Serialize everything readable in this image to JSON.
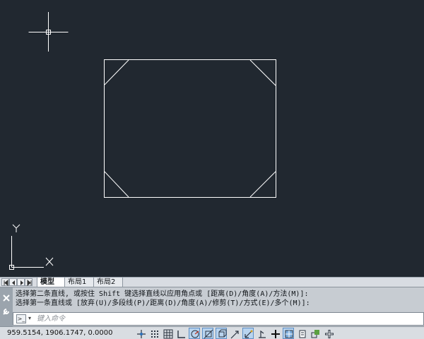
{
  "layout_tabs": [
    {
      "label": "模型",
      "active": true
    },
    {
      "label": "布局1",
      "active": false
    },
    {
      "label": "布局2",
      "active": false
    }
  ],
  "command": {
    "history": [
      "选择第二条直线, 或按住 Shift 键选择直线以应用角点或 [距离(D)/角度(A)/方法(M)]:",
      "选择第一条直线或 [放弃(U)/多段线(P)/距离(D)/角度(A)/修剪(T)/方式(E)/多个(M)]:"
    ],
    "input_value": "",
    "placeholder": "键入命令"
  },
  "status": {
    "coordinates": "959.5154,  1906.1747, 0.0000"
  },
  "ucs": {
    "x_label": "X",
    "y_label": "Y"
  },
  "colors": {
    "canvas_bg": "#212830",
    "geometry": "#ffffff",
    "toggle_active": "#b9d4ef"
  },
  "icons": {
    "gutter": [
      "close-icon",
      "wrench-icon"
    ],
    "status_toggles": [
      "model-space-icon",
      "snap-grid-icon",
      "grid-display-icon",
      "ortho-icon",
      "polar-tracking-icon",
      "object-snap-icon",
      "object-snap-3d-icon",
      "object-snap-tracking-icon",
      "dynamic-ucs-icon",
      "dynamic-input-icon",
      "lineweight-icon",
      "transparency-icon",
      "quick-properties-icon",
      "selection-cycling-icon",
      "annotation-monitor-icon"
    ]
  }
}
